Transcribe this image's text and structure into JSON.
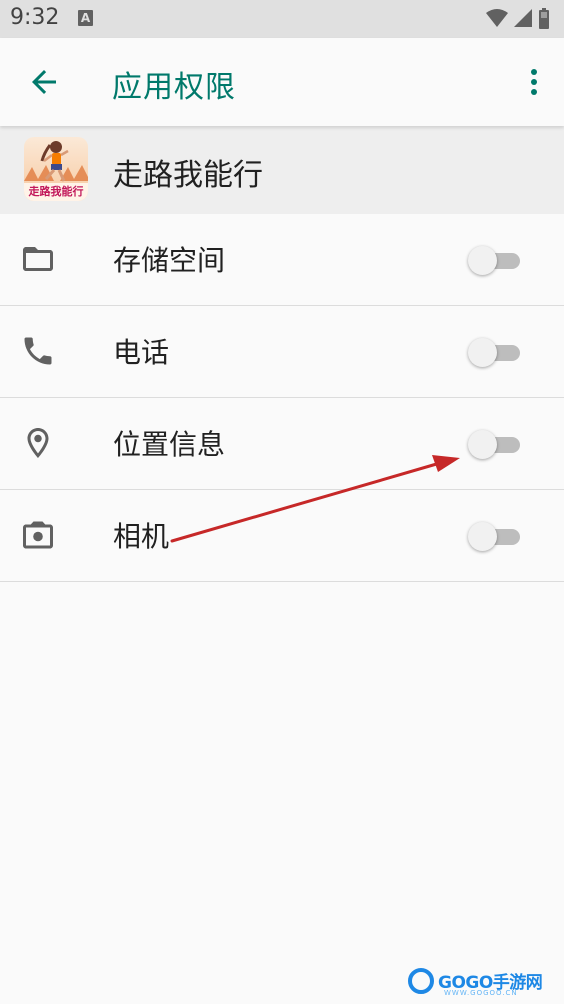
{
  "status_bar": {
    "time": "9:32",
    "notification_icon": "A"
  },
  "app_bar": {
    "title": "应用权限",
    "back_icon": "arrow-left-icon",
    "more_icon": "more-vert-icon"
  },
  "app": {
    "name": "走路我能行",
    "icon_text": "走路我能行"
  },
  "permissions": [
    {
      "label": "存储空间",
      "icon": "folder-icon",
      "enabled": false
    },
    {
      "label": "电话",
      "icon": "phone-icon",
      "enabled": false
    },
    {
      "label": "位置信息",
      "icon": "location-icon",
      "enabled": false
    },
    {
      "label": "相机",
      "icon": "camera-icon",
      "enabled": false
    }
  ],
  "watermark": {
    "text": "GOGO手游网",
    "sub": "WWW.GOGOO.CN"
  },
  "colors": {
    "accent": "#00796b",
    "annotation_arrow": "#c62828"
  }
}
